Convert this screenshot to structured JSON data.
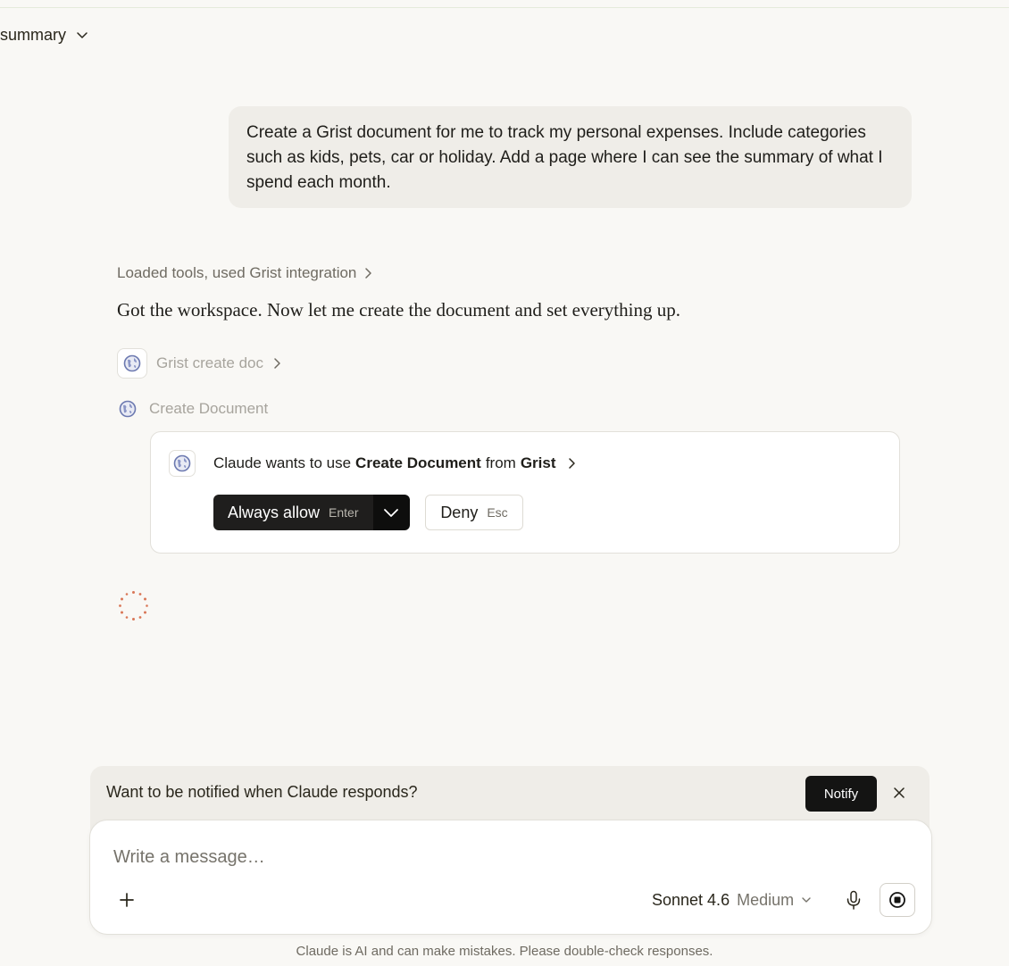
{
  "header": {
    "title": "summary"
  },
  "conversation": {
    "user_message": "Create a Grist document for me to track my personal expenses. Include categories such as kids, pets, car or holiday. Add a page where I can see the summary of what I spend each month.",
    "tools_summary": "Loaded tools, used Grist integration",
    "assistant_text": "Got the workspace. Now let me create the document and set everything up.",
    "tool_call_1": "Grist create doc",
    "tool_call_2": "Create Document"
  },
  "permission": {
    "prefix": "Claude wants to use",
    "tool_name": "Create Document",
    "middle": "from",
    "integration": "Grist",
    "allow_label": "Always allow",
    "allow_key": "Enter",
    "deny_label": "Deny",
    "deny_key": "Esc"
  },
  "notify": {
    "text": "Want to be notified when Claude responds?",
    "button": "Notify"
  },
  "composer": {
    "placeholder": "Write a message…",
    "model": "Sonnet 4.6",
    "effort": "Medium"
  },
  "footer": {
    "disclaimer": "Claude is AI and can make mistakes. Please double-check responses."
  },
  "colors": {
    "background": "#f9f8f5",
    "user_bubble": "#efede8",
    "primary_button": "#1f1e1d",
    "spinner": "#d97757"
  },
  "icons": {
    "tool": "globe-icon",
    "title_dropdown": "chevron-down-icon",
    "expand": "chevron-right-icon",
    "close": "close-icon",
    "add": "plus-icon",
    "mic": "microphone-icon",
    "stop": "stop-icon",
    "loading": "spinner-icon"
  }
}
